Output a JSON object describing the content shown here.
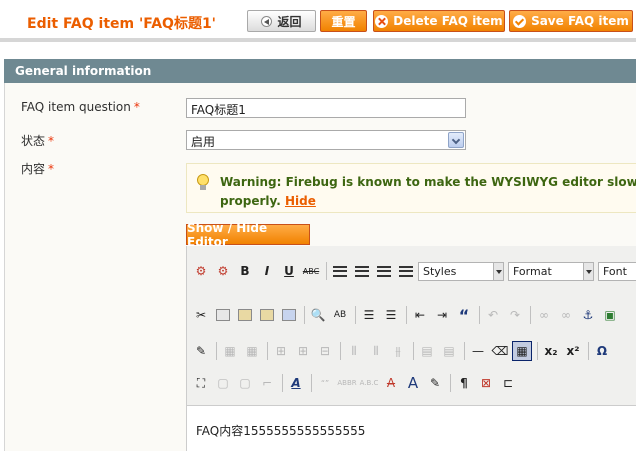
{
  "header": {
    "title": "Edit FAQ item 'FAQ标题1'",
    "buttons": {
      "back": "返回",
      "reset": "重置",
      "delete": "Delete FAQ item",
      "save": "Save FAQ item"
    }
  },
  "panel": {
    "title": "General information"
  },
  "form": {
    "question_label": "FAQ item question",
    "question_value": "FAQ标题1",
    "status_label": "状态",
    "status_value": "启用",
    "content_label": "内容",
    "required_mark": "*"
  },
  "warning": {
    "line1": "Warning: Firebug is known to make the WYSIWYG editor slow unless it is t",
    "line2": "properly.",
    "hide_link": "Hide"
  },
  "editor": {
    "toggle_label": "Show / Hide Editor",
    "styles_dropdown": "Styles",
    "format_dropdown": "Format",
    "font_dropdown": "Font",
    "content": "FAQ内容1555555555555555"
  },
  "colors": {
    "accent": "#eb5e00",
    "button_orange": "#f18200",
    "panel_header": "#6f8992",
    "warning_text": "#3d6611"
  }
}
